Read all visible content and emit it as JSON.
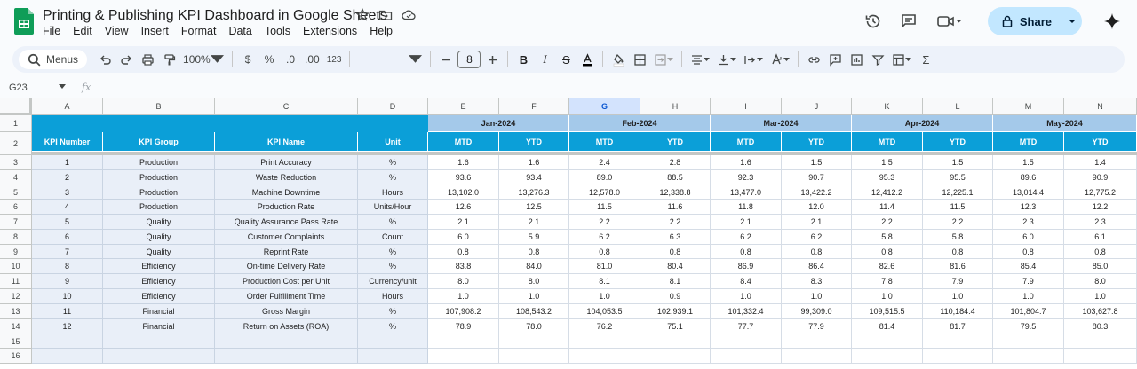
{
  "app": {
    "doc_title": "Printing & Publishing KPI Dashboard in Google Sheets",
    "menu": [
      "File",
      "Edit",
      "View",
      "Insert",
      "Format",
      "Data",
      "Tools",
      "Extensions",
      "Help"
    ],
    "share_label": "Share",
    "brand_color": "#0f9d58",
    "accent_color": "#c2e7ff"
  },
  "toolbar": {
    "search_label": "Menus",
    "zoom": "100%",
    "currency": "$",
    "percent": "%",
    "dec_decrease": ".0",
    "dec_increase": ".00",
    "number_format": "123",
    "font_size": "8",
    "icons": [
      "search-icon",
      "undo-icon",
      "redo-icon",
      "print-icon",
      "paint-format-icon",
      "zoom-dropdown",
      "currency-icon",
      "percent-icon",
      "decrease-decimal-icon",
      "increase-decimal-icon",
      "number-format-icon",
      "font-dropdown",
      "minus-icon",
      "plus-icon",
      "bold-icon",
      "italic-icon",
      "strikethrough-icon",
      "text-color-icon",
      "fill-color-icon",
      "borders-icon",
      "merge-icon",
      "align-icon",
      "valign-icon",
      "wrap-icon",
      "rotate-icon",
      "link-icon",
      "comment-icon",
      "chart-icon",
      "filter-icon",
      "filter-views-icon",
      "functions-icon"
    ]
  },
  "formula_bar": {
    "name_box": "G23",
    "fx": "fx",
    "value": ""
  },
  "sheet": {
    "selected_column": "G",
    "header_colors": {
      "dark": "#0b9fd8",
      "light": "#a4c9ea",
      "row_band": "#e9eff8"
    },
    "columns": [
      "A",
      "B",
      "C",
      "D",
      "E",
      "F",
      "G",
      "H",
      "I",
      "J",
      "K",
      "L",
      "M",
      "N"
    ],
    "row_numbers": [
      "1",
      "2",
      "3",
      "4",
      "5",
      "6",
      "7",
      "8",
      "9",
      "10",
      "11",
      "12",
      "13",
      "14",
      "15",
      "16"
    ],
    "headers": {
      "kpi_number": "KPI Number",
      "kpi_group": "KPI Group",
      "kpi_name": "KPI Name",
      "unit": "Unit",
      "months": [
        "Jan-2024",
        "Feb-2024",
        "Mar-2024",
        "Apr-2024",
        "May-2024"
      ],
      "mtd": "MTD",
      "ytd": "YTD"
    },
    "rows": [
      {
        "num": "1",
        "group": "Production",
        "name": "Print Accuracy",
        "unit": "%",
        "vals": [
          "1.6",
          "1.6",
          "2.4",
          "2.8",
          "1.6",
          "1.5",
          "1.5",
          "1.5",
          "1.5",
          "1.4"
        ]
      },
      {
        "num": "2",
        "group": "Production",
        "name": "Waste Reduction",
        "unit": "%",
        "vals": [
          "93.6",
          "93.4",
          "89.0",
          "88.5",
          "92.3",
          "90.7",
          "95.3",
          "95.5",
          "89.6",
          "90.9"
        ]
      },
      {
        "num": "3",
        "group": "Production",
        "name": "Machine Downtime",
        "unit": "Hours",
        "vals": [
          "13,102.0",
          "13,276.3",
          "12,578.0",
          "12,338.8",
          "13,477.0",
          "13,422.2",
          "12,412.2",
          "12,225.1",
          "13,014.4",
          "12,775.2"
        ]
      },
      {
        "num": "4",
        "group": "Production",
        "name": "Production Rate",
        "unit": "Units/Hour",
        "vals": [
          "12.6",
          "12.5",
          "11.5",
          "11.6",
          "11.8",
          "12.0",
          "11.4",
          "11.5",
          "12.3",
          "12.2"
        ]
      },
      {
        "num": "5",
        "group": "Quality",
        "name": "Quality Assurance Pass Rate",
        "unit": "%",
        "vals": [
          "2.1",
          "2.1",
          "2.2",
          "2.2",
          "2.1",
          "2.1",
          "2.2",
          "2.2",
          "2.3",
          "2.3"
        ]
      },
      {
        "num": "6",
        "group": "Quality",
        "name": "Customer Complaints",
        "unit": "Count",
        "vals": [
          "6.0",
          "5.9",
          "6.2",
          "6.3",
          "6.2",
          "6.2",
          "5.8",
          "5.8",
          "6.0",
          "6.1"
        ]
      },
      {
        "num": "7",
        "group": "Quality",
        "name": "Reprint Rate",
        "unit": "%",
        "vals": [
          "0.8",
          "0.8",
          "0.8",
          "0.8",
          "0.8",
          "0.8",
          "0.8",
          "0.8",
          "0.8",
          "0.8"
        ]
      },
      {
        "num": "8",
        "group": "Efficiency",
        "name": "On-time Delivery Rate",
        "unit": "%",
        "vals": [
          "83.8",
          "84.0",
          "81.0",
          "80.4",
          "86.9",
          "86.4",
          "82.6",
          "81.6",
          "85.4",
          "85.0"
        ]
      },
      {
        "num": "9",
        "group": "Efficiency",
        "name": "Production Cost per Unit",
        "unit": "Currency/unit",
        "vals": [
          "8.0",
          "8.0",
          "8.1",
          "8.1",
          "8.4",
          "8.3",
          "7.8",
          "7.9",
          "7.9",
          "8.0"
        ]
      },
      {
        "num": "10",
        "group": "Efficiency",
        "name": "Order Fulfillment Time",
        "unit": "Hours",
        "vals": [
          "1.0",
          "1.0",
          "1.0",
          "0.9",
          "1.0",
          "1.0",
          "1.0",
          "1.0",
          "1.0",
          "1.0"
        ]
      },
      {
        "num": "11",
        "group": "Financial",
        "name": "Gross Margin",
        "unit": "%",
        "vals": [
          "107,908.2",
          "108,543.2",
          "104,053.5",
          "102,939.1",
          "101,332.4",
          "99,309.0",
          "109,515.5",
          "110,184.4",
          "101,804.7",
          "103,627.8"
        ]
      },
      {
        "num": "12",
        "group": "Financial",
        "name": "Return on Assets (ROA)",
        "unit": "%",
        "vals": [
          "78.9",
          "78.0",
          "76.2",
          "75.1",
          "77.7",
          "77.9",
          "81.4",
          "81.7",
          "79.5",
          "80.3"
        ]
      }
    ]
  }
}
